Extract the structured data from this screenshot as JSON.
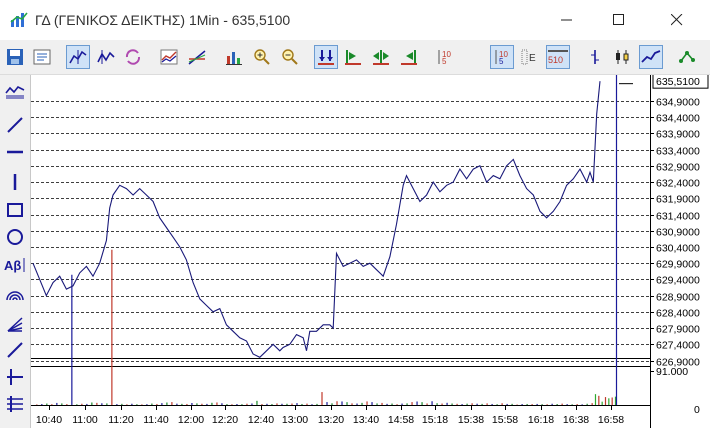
{
  "window": {
    "title": "ΓΔ (ΓΕΝΙΚΟΣ ΔΕΙΚΤΗΣ) 1Min - 635,5100"
  },
  "toolbar": {
    "buttons": [
      {
        "name": "save-icon"
      },
      {
        "name": "properties-icon"
      },
      {
        "name": "chart-mode-icon",
        "active": true
      },
      {
        "name": "chart-mode-alt-icon"
      },
      {
        "name": "refresh-icon"
      },
      {
        "name": "indicator-icon"
      },
      {
        "name": "studies-icon"
      },
      {
        "name": "volume-bars-icon"
      },
      {
        "name": "zoom-in-icon"
      },
      {
        "name": "zoom-out-icon"
      },
      {
        "name": "scroll-both-icon",
        "active": true
      },
      {
        "name": "scroll-left-icon"
      },
      {
        "name": "scroll-center-icon"
      },
      {
        "name": "scroll-right-icon"
      },
      {
        "name": "digits-icon"
      },
      {
        "name": "depth-icon",
        "active": true
      },
      {
        "name": "depth-alt-icon"
      },
      {
        "name": "depth-510-icon",
        "active": true
      },
      {
        "name": "bar-style-icon"
      },
      {
        "name": "candle-style-icon"
      },
      {
        "name": "line-style-icon",
        "active": true
      },
      {
        "name": "pattern-icon"
      }
    ]
  },
  "left_tools": [
    "indicator-list-icon",
    "trend-line-icon",
    "horizontal-line-icon",
    "vertical-line-icon",
    "rectangle-icon",
    "ellipse-icon",
    "text-tool-icon",
    "arc-icon",
    "fan-icon",
    "angle-line-icon",
    "cross-tool-icon",
    "fibonacci-icon"
  ],
  "chart_data": {
    "type": "line",
    "title": "ΓΔ (ΓΕΝΙΚΟΣ ΔΕΙΚΤΗΣ) 1Min",
    "last_value_label": "635,5100",
    "price_axis_ticks": [
      "634,9000",
      "634,4000",
      "633,9000",
      "633,4000",
      "632,9000",
      "632,4000",
      "631,9000",
      "631,4000",
      "630,9000",
      "630,4000",
      "629,9000",
      "629,4000",
      "628,9000",
      "628,4000",
      "627,9000",
      "627,4000",
      "626,9000"
    ],
    "ylim": [
      626.7,
      635.7
    ],
    "volume_axis_ticks": [
      "91.000",
      "0"
    ],
    "volume_ylim": [
      0,
      91000
    ],
    "time_labels": [
      "10:40",
      "11:00",
      "11:20",
      "11:40",
      "12:00",
      "12:20",
      "12:40",
      "13:00",
      "13:20",
      "13:40",
      "14:58",
      "15:18",
      "15:38",
      "15:58",
      "16:18",
      "16:38",
      "16:58"
    ],
    "gridlines": true,
    "price_series": [
      [
        0,
        629.9
      ],
      [
        4,
        629.4
      ],
      [
        8,
        628.9
      ],
      [
        12,
        629.3
      ],
      [
        16,
        629.5
      ],
      [
        20,
        629.1
      ],
      [
        24,
        629.2
      ],
      [
        28,
        629.6
      ],
      [
        32,
        629.8
      ],
      [
        36,
        629.5
      ],
      [
        40,
        629.9
      ],
      [
        44,
        630.6
      ],
      [
        46,
        631.6
      ],
      [
        48,
        632.0
      ],
      [
        52,
        632.3
      ],
      [
        56,
        632.2
      ],
      [
        60,
        632.0
      ],
      [
        64,
        632.2
      ],
      [
        68,
        632.0
      ],
      [
        72,
        631.8
      ],
      [
        76,
        631.3
      ],
      [
        80,
        631.0
      ],
      [
        84,
        630.7
      ],
      [
        88,
        630.4
      ],
      [
        92,
        630.0
      ],
      [
        96,
        629.3
      ],
      [
        100,
        628.8
      ],
      [
        104,
        628.6
      ],
      [
        108,
        628.4
      ],
      [
        112,
        628.5
      ],
      [
        116,
        628.0
      ],
      [
        120,
        627.8
      ],
      [
        124,
        627.6
      ],
      [
        128,
        627.5
      ],
      [
        132,
        627.1
      ],
      [
        136,
        627.0
      ],
      [
        140,
        627.2
      ],
      [
        144,
        627.4
      ],
      [
        148,
        627.2
      ],
      [
        150,
        627.3
      ],
      [
        154,
        627.4
      ],
      [
        158,
        627.7
      ],
      [
        162,
        627.6
      ],
      [
        164,
        627.2
      ],
      [
        166,
        627.8
      ],
      [
        170,
        627.8
      ],
      [
        174,
        628.0
      ],
      [
        178,
        628.0
      ],
      [
        180,
        627.9
      ],
      [
        182,
        630.2
      ],
      [
        186,
        629.8
      ],
      [
        190,
        629.9
      ],
      [
        194,
        630.0
      ],
      [
        198,
        629.8
      ],
      [
        202,
        629.9
      ],
      [
        206,
        629.7
      ],
      [
        210,
        629.5
      ],
      [
        214,
        630.1
      ],
      [
        218,
        631.1
      ],
      [
        222,
        632.3
      ],
      [
        224,
        632.6
      ],
      [
        228,
        632.2
      ],
      [
        232,
        631.8
      ],
      [
        236,
        632.0
      ],
      [
        240,
        632.4
      ],
      [
        244,
        632.1
      ],
      [
        248,
        632.3
      ],
      [
        252,
        632.4
      ],
      [
        256,
        632.8
      ],
      [
        260,
        632.5
      ],
      [
        264,
        632.8
      ],
      [
        268,
        632.9
      ],
      [
        272,
        632.4
      ],
      [
        276,
        632.6
      ],
      [
        280,
        632.5
      ],
      [
        284,
        632.9
      ],
      [
        288,
        633.1
      ],
      [
        292,
        632.6
      ],
      [
        296,
        632.2
      ],
      [
        300,
        632.0
      ],
      [
        304,
        631.5
      ],
      [
        308,
        631.3
      ],
      [
        312,
        631.5
      ],
      [
        316,
        631.8
      ],
      [
        320,
        632.3
      ],
      [
        324,
        632.5
      ],
      [
        328,
        632.8
      ],
      [
        332,
        632.4
      ],
      [
        334,
        632.7
      ],
      [
        336,
        632.4
      ],
      [
        338,
        634.5
      ],
      [
        340,
        635.51
      ]
    ],
    "volume_series": [
      [
        2,
        1400
      ],
      [
        5,
        2400
      ],
      [
        8,
        3500
      ],
      [
        11,
        2000
      ],
      [
        14,
        5000
      ],
      [
        17,
        3800
      ],
      [
        20,
        2200
      ],
      [
        23,
        54000
      ],
      [
        26,
        1800
      ],
      [
        29,
        3000
      ],
      [
        32,
        2600
      ],
      [
        35,
        6000
      ],
      [
        38,
        5200
      ],
      [
        41,
        4100
      ],
      [
        44,
        3800
      ],
      [
        47,
        61000
      ],
      [
        50,
        2200
      ],
      [
        53,
        2800
      ],
      [
        56,
        1600
      ],
      [
        59,
        3000
      ],
      [
        62,
        1900
      ],
      [
        65,
        1500
      ],
      [
        68,
        2000
      ],
      [
        71,
        3500
      ],
      [
        74,
        2500
      ],
      [
        77,
        4500
      ],
      [
        80,
        6000
      ],
      [
        83,
        7000
      ],
      [
        86,
        3200
      ],
      [
        89,
        2800
      ],
      [
        92,
        2500
      ],
      [
        95,
        4800
      ],
      [
        98,
        3900
      ],
      [
        101,
        3000
      ],
      [
        104,
        2700
      ],
      [
        107,
        5300
      ],
      [
        110,
        6100
      ],
      [
        113,
        4200
      ],
      [
        116,
        2200
      ],
      [
        119,
        1800
      ],
      [
        122,
        2400
      ],
      [
        125,
        2000
      ],
      [
        128,
        3100
      ],
      [
        131,
        3600
      ],
      [
        134,
        10000
      ],
      [
        137,
        2300
      ],
      [
        140,
        2900
      ],
      [
        143,
        2300
      ],
      [
        146,
        3800
      ],
      [
        149,
        2900
      ],
      [
        152,
        3000
      ],
      [
        155,
        3500
      ],
      [
        158,
        4500
      ],
      [
        161,
        2500
      ],
      [
        164,
        3300
      ],
      [
        167,
        1900
      ],
      [
        170,
        2700
      ],
      [
        173,
        31000
      ],
      [
        176,
        7000
      ],
      [
        179,
        4000
      ],
      [
        182,
        9000
      ],
      [
        185,
        8500
      ],
      [
        188,
        6800
      ],
      [
        191,
        3900
      ],
      [
        194,
        3500
      ],
      [
        197,
        5100
      ],
      [
        200,
        8600
      ],
      [
        203,
        6900
      ],
      [
        206,
        3800
      ],
      [
        209,
        5000
      ],
      [
        212,
        2800
      ],
      [
        215,
        3500
      ],
      [
        218,
        1900
      ],
      [
        221,
        3400
      ],
      [
        224,
        3900
      ],
      [
        227,
        7000
      ],
      [
        230,
        8400
      ],
      [
        233,
        6800
      ],
      [
        236,
        3700
      ],
      [
        239,
        9000
      ],
      [
        242,
        4300
      ],
      [
        245,
        3500
      ],
      [
        248,
        5300
      ],
      [
        251,
        3600
      ],
      [
        254,
        2900
      ],
      [
        257,
        2200
      ],
      [
        260,
        3200
      ],
      [
        263,
        4100
      ],
      [
        266,
        3100
      ],
      [
        269,
        2700
      ],
      [
        272,
        3900
      ],
      [
        275,
        2500
      ],
      [
        278,
        1900
      ],
      [
        281,
        4200
      ],
      [
        284,
        2600
      ],
      [
        287,
        2800
      ],
      [
        290,
        1200
      ],
      [
        293,
        2300
      ],
      [
        296,
        2500
      ],
      [
        299,
        2200
      ],
      [
        302,
        2600
      ],
      [
        305,
        2000
      ],
      [
        308,
        1800
      ],
      [
        311,
        3000
      ],
      [
        314,
        2400
      ],
      [
        317,
        3300
      ],
      [
        320,
        2100
      ],
      [
        323,
        1700
      ],
      [
        326,
        2300
      ],
      [
        329,
        1600
      ],
      [
        332,
        3000
      ],
      [
        335,
        4500
      ],
      [
        337,
        26000
      ],
      [
        339,
        22000
      ],
      [
        341,
        8000
      ],
      [
        343,
        19000
      ],
      [
        345,
        16000
      ],
      [
        347,
        18000
      ],
      [
        349,
        20000
      ]
    ]
  }
}
